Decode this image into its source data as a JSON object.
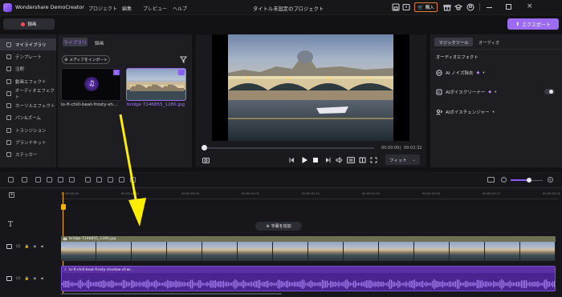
{
  "app": {
    "name": "Wondershare DemoCreator",
    "project_title": "タイトル未設定のプロジェクト",
    "menu": [
      "プロジェクト",
      "編集",
      "プレビュー",
      "ヘルプ"
    ],
    "purchase_label": "購入"
  },
  "toolbar": {
    "record_label": "録画",
    "export_label": "エクスポート"
  },
  "sidebar": {
    "items": [
      {
        "label": "マイライブラリ",
        "icon": "library-icon",
        "active": true
      },
      {
        "label": "テンプレート",
        "icon": "template-icon"
      },
      {
        "label": "注釈",
        "icon": "annotation-icon"
      },
      {
        "label": "動画エフェクト",
        "icon": "video-effect-icon"
      },
      {
        "label": "オーディオエフェクト",
        "icon": "audio-effect-icon"
      },
      {
        "label": "カーソルエフェクト",
        "icon": "cursor-effect-icon"
      },
      {
        "label": "パン&ズーム",
        "icon": "pan-zoom-icon"
      },
      {
        "label": "トランジション",
        "icon": "transition-icon"
      },
      {
        "label": "ブランドキット",
        "icon": "brand-kit-icon"
      },
      {
        "label": "ステッカー",
        "icon": "sticker-icon"
      }
    ]
  },
  "library": {
    "tabs": [
      "ライブラリ",
      "録画"
    ],
    "import_label": "メディアをインポート",
    "items": [
      {
        "name": "lo-fi-chill-beat-frosty-sh...",
        "type": "audio"
      },
      {
        "name": "bridge 7246855_1280.jpg",
        "type": "image"
      }
    ]
  },
  "player": {
    "current_time": "00:00:00",
    "total_time": "00:02:32",
    "fit_label": "フィット"
  },
  "right_panel": {
    "tabs": [
      "マジックツール",
      "オーディオ"
    ],
    "section_title": "オーディオエフェクト",
    "effects": [
      {
        "label": "AI ノイズ除去",
        "has_gem": true,
        "has_toggle": false
      },
      {
        "label": "AIボイスクリーナー",
        "has_gem": true,
        "has_toggle": true
      },
      {
        "label": "AIボイスチェンジャー",
        "has_gem": false,
        "has_toggle": false
      }
    ]
  },
  "timeline": {
    "ticks": [
      "00:00:00:00",
      "00:00:00:10",
      "00:00:00:20",
      "00:00:01:05",
      "00:00:01:15",
      "00:00:01:25",
      "00:00:02:05",
      "00:00:02:15",
      "00:00:02:25"
    ],
    "add_caption_label": "字幕を追加",
    "tracks": [
      {
        "number": "02",
        "clip_label": "bridge-7246855_1280.jpg"
      },
      {
        "number": "01",
        "clip_label": "lo-fi-chill-beat-frosty-shadow-of-wi..."
      }
    ]
  },
  "colors": {
    "accent": "#8a5cf6",
    "export": "#9b6cf2",
    "arrow": "#ffee00",
    "audio_clip": "#5d2fa5",
    "video_clip_header": "#7a7a5a"
  }
}
